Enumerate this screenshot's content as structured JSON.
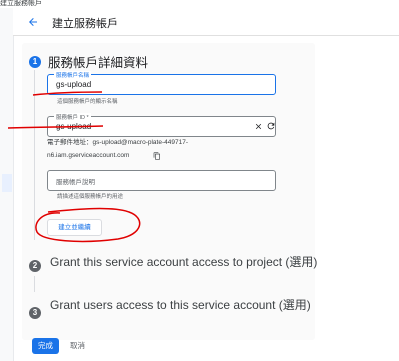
{
  "window": {
    "title": "建立服務帳戶"
  },
  "header": {
    "title": "建立服務帳戶"
  },
  "steps": [
    {
      "number": "1",
      "title": "服務帳戶詳細資料"
    },
    {
      "number": "2",
      "title": "Grant this service account access to project (選用)"
    },
    {
      "number": "3",
      "title": "Grant users access to this service account (選用)"
    }
  ],
  "form": {
    "name_field": {
      "label": "服務帳戶名稱",
      "value": "gs-upload",
      "hint": "這個服務帳戶的顯示名稱"
    },
    "id_field": {
      "label": "服務帳戶 ID *",
      "value": "gs-upload"
    },
    "email": {
      "line1": "電子郵件地址：gs-upload@macro-plate-449717-",
      "line2": "n6.iam.gserviceaccount.com"
    },
    "description_field": {
      "placeholder": "服務帳戶說明",
      "hint": "請描述這個服務帳戶的用途"
    },
    "create_button": "建立並繼續"
  },
  "footer": {
    "done_button": "完成",
    "cancel_button": "取消"
  },
  "icons": {
    "back": "arrow-left-icon",
    "clear": "close-icon",
    "refresh": "refresh-icon",
    "copy": "copy-icon"
  },
  "colors": {
    "accent": "#1a73e8",
    "annotation": "#e00000"
  }
}
